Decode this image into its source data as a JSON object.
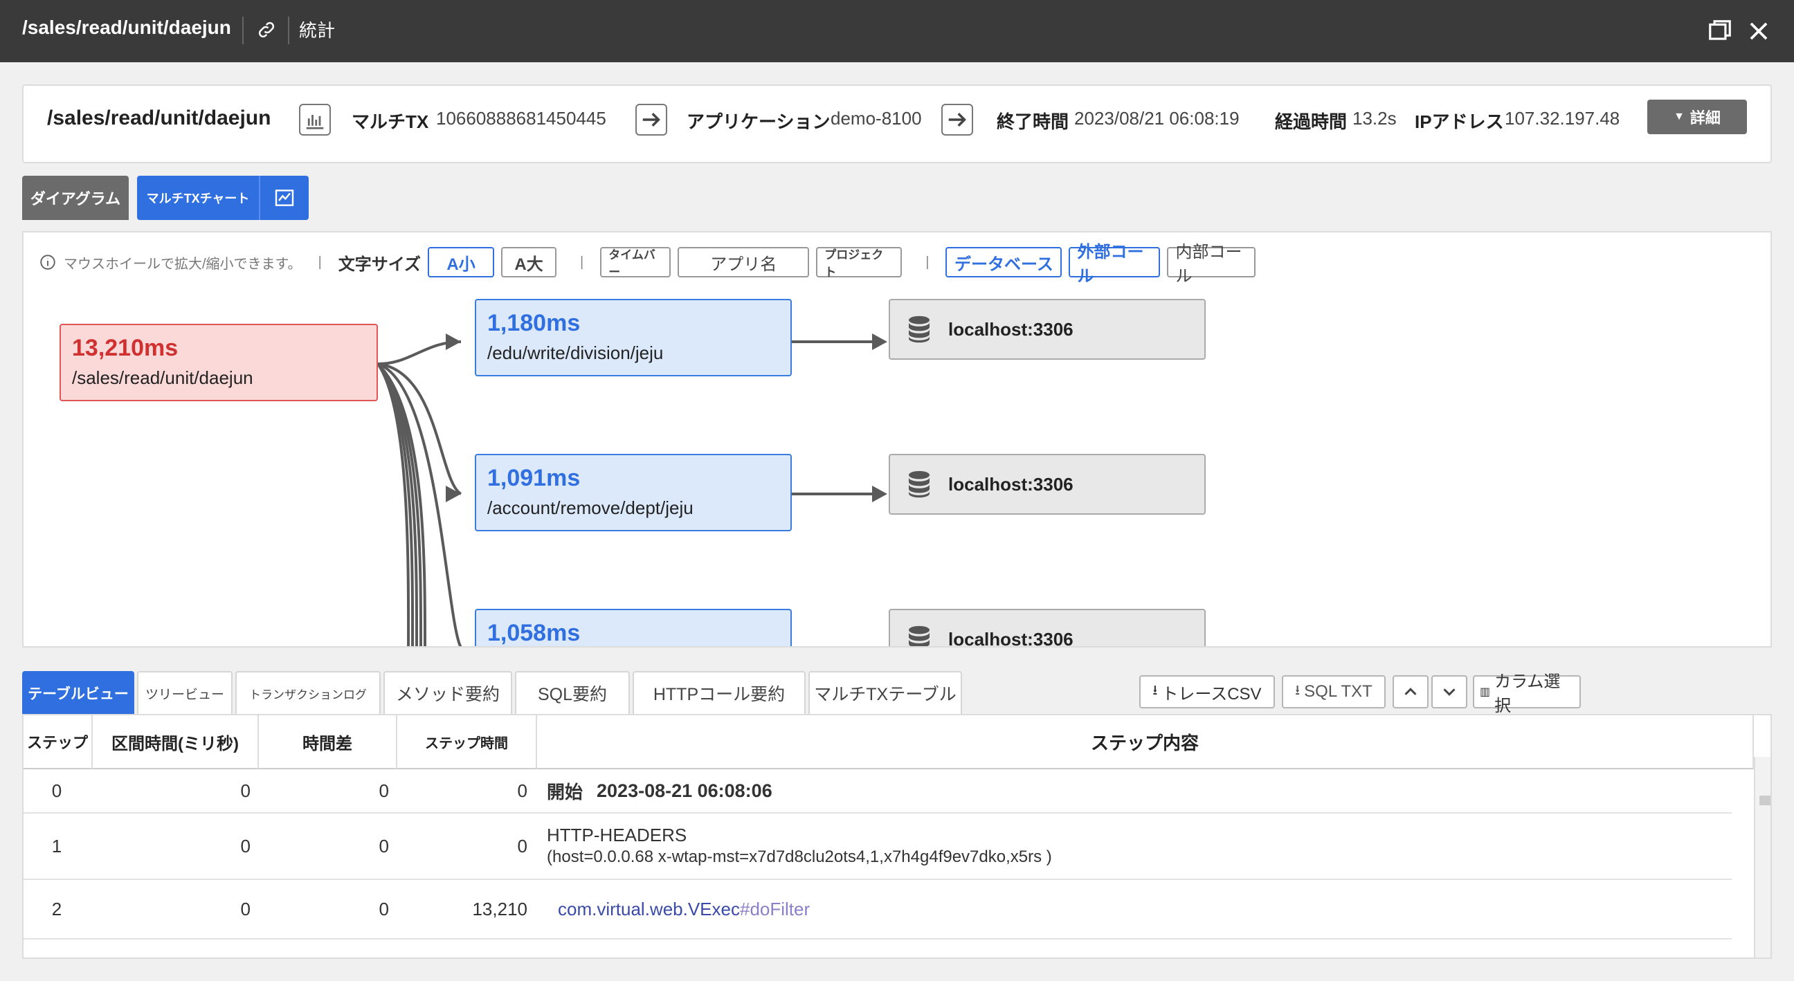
{
  "titlebar": {
    "path": "/sales/read/unit/daejun",
    "stats_label": "統計"
  },
  "info": {
    "title": "/sales/read/unit/daejun",
    "multitx_label": "マルチTX",
    "multitx_value": "10660888681450445",
    "app_label": "アプリケーション",
    "app_value": "demo-8100",
    "end_label": "終了時間",
    "end_value": "2023/08/21 06:08:19",
    "elapsed_label": "経過時間",
    "elapsed_value": "13.2s",
    "ip_label": "IPアドレス",
    "ip_value": "107.32.197.48",
    "detail_label": "詳細"
  },
  "view_tabs": {
    "diagram": "ダイアグラム",
    "multitx_chart": "マルチTXチャート"
  },
  "toolbar": {
    "hint": "マウスホイールで拡大/縮小できます。",
    "font_size_label": "文字サイズ",
    "small": "A小",
    "large": "A大",
    "timebar": "タイムバー",
    "app_name": "アプリ名",
    "project": "プロジェクト",
    "database": "データベース",
    "external_call": "外部コール",
    "internal_call": "内部コール"
  },
  "diagram": {
    "root": {
      "ms": "13,210ms",
      "path": "/sales/read/unit/daejun"
    },
    "services": [
      {
        "ms": "1,180ms",
        "path": "/edu/write/division/jeju",
        "db": "localhost:3306"
      },
      {
        "ms": "1,091ms",
        "path": "/account/remove/dept/jeju",
        "db": "localhost:3306"
      },
      {
        "ms": "1,058ms",
        "path": "",
        "db": "localhost:3306"
      }
    ]
  },
  "tabs": {
    "table_view": "テーブルビュー",
    "tree_view": "ツリービュー",
    "tx_log": "トランザクションログ",
    "method_summary": "メソッド要約",
    "sql_summary": "SQL要約",
    "http_summary": "HTTPコール要約",
    "multitx_table": "マルチTXテーブル"
  },
  "actions": {
    "trace_csv": "トレースCSV",
    "sql_txt": "SQL TXT",
    "column_select": "カラム選択"
  },
  "table": {
    "headers": [
      "ステップ",
      "区間時間(ミリ秒)",
      "時間差",
      "ステップ時間",
      "ステップ内容"
    ],
    "rows": [
      {
        "step": "0",
        "interval": "0",
        "diff": "0",
        "steptime": "0",
        "content_label": "開始",
        "content": "2023-08-21 06:08:06"
      },
      {
        "step": "1",
        "interval": "0",
        "diff": "0",
        "steptime": "0",
        "content": "HTTP-HEADERS",
        "content2": "(host=0.0.0.68 x-wtap-mst=x7d7d8clu2ots4,1,x7h4g4f9ev7dko,x5rs )"
      },
      {
        "step": "2",
        "interval": "0",
        "diff": "0",
        "steptime": "13,210",
        "content": "com.virtual.web.VExec",
        "content_method": "#doFilter"
      }
    ]
  }
}
